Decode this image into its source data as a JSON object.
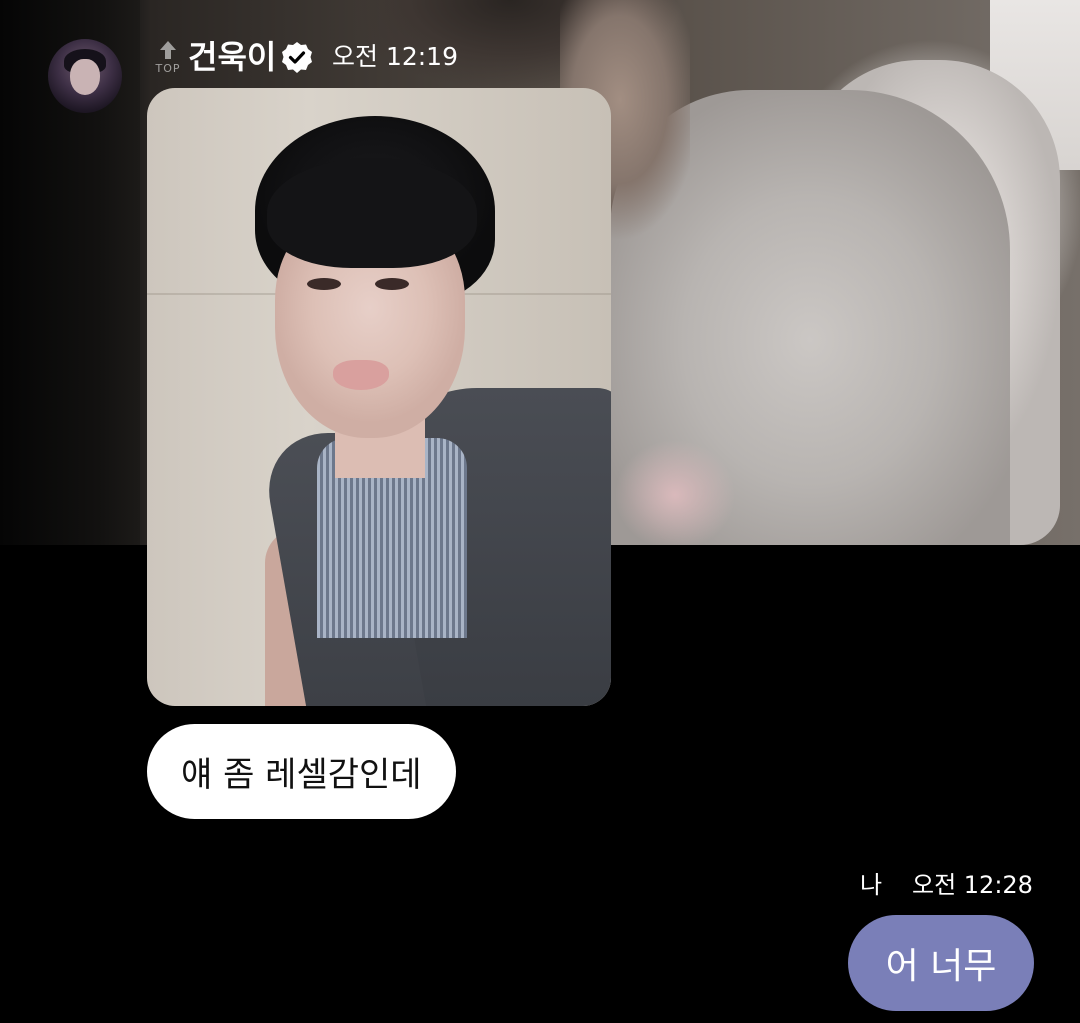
{
  "header": {
    "rank_badge": "TOP",
    "sender_name": "건욱이",
    "time": "오전 12:19",
    "avatar_icon": "profile-avatar",
    "verified_icon": "verified-check-badge"
  },
  "messages": [
    {
      "type": "photo",
      "from": "건욱이",
      "alt_icon": "selfie-photo"
    },
    {
      "type": "text",
      "from": "건욱이",
      "text": "얘 좀 레셀감인데"
    },
    {
      "type": "text",
      "from": "나",
      "sender_label": "나",
      "time": "오전 12:28",
      "text": "어 너무"
    }
  ],
  "colors": {
    "background": "#000000",
    "incoming_bubble": "#ffffff",
    "outgoing_bubble": "#7a7fb8",
    "text_light": "#ffffff",
    "text_dark": "#111111"
  }
}
